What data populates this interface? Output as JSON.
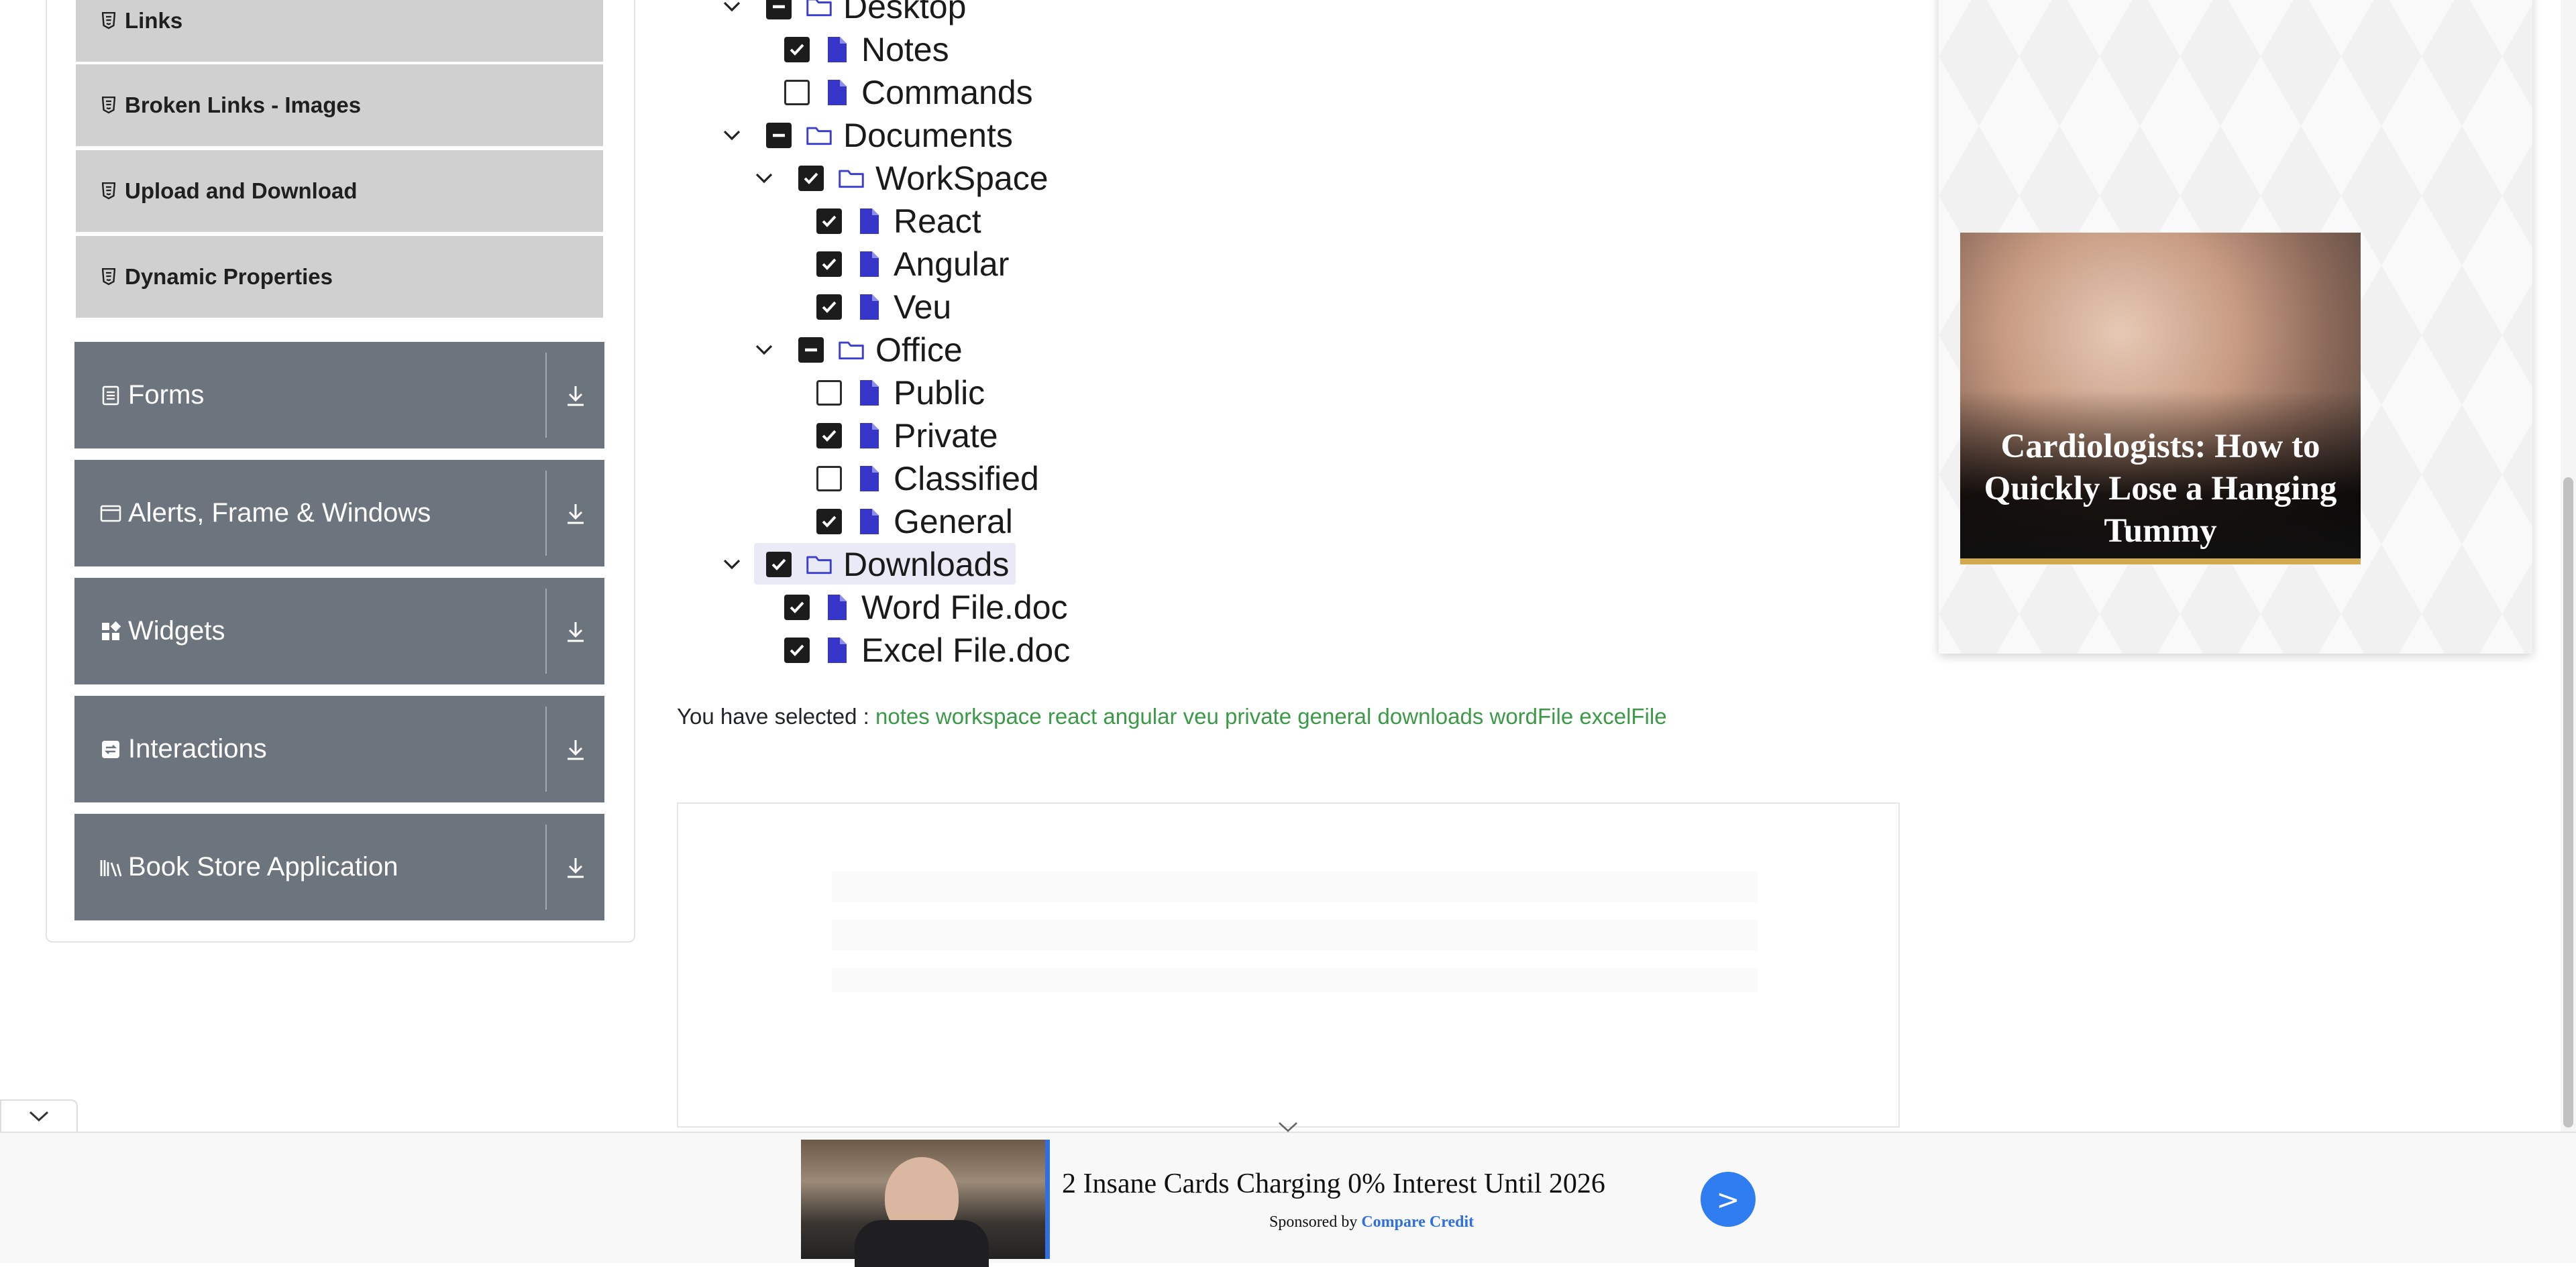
{
  "sidebar": {
    "sub_items": [
      {
        "label": "Links"
      },
      {
        "label": "Broken Links - Images"
      },
      {
        "label": "Upload and Download"
      },
      {
        "label": "Dynamic Properties"
      }
    ],
    "groups": [
      {
        "label": "Forms",
        "icon": "form-icon"
      },
      {
        "label": "Alerts, Frame & Windows",
        "icon": "window-icon"
      },
      {
        "label": "Widgets",
        "icon": "widgets-icon"
      },
      {
        "label": "Interactions",
        "icon": "interactions-icon"
      },
      {
        "label": "Book Store Application",
        "icon": "books-icon"
      }
    ]
  },
  "tree": {
    "nodes": [
      {
        "label": "Desktop",
        "state": "half",
        "type": "folder",
        "expanded": true
      },
      {
        "label": "Notes",
        "state": "checked",
        "type": "file"
      },
      {
        "label": "Commands",
        "state": "unchecked",
        "type": "file"
      },
      {
        "label": "Documents",
        "state": "half",
        "type": "folder",
        "expanded": true
      },
      {
        "label": "WorkSpace",
        "state": "checked",
        "type": "folder",
        "expanded": true
      },
      {
        "label": "React",
        "state": "checked",
        "type": "file"
      },
      {
        "label": "Angular",
        "state": "checked",
        "type": "file"
      },
      {
        "label": "Veu",
        "state": "checked",
        "type": "file"
      },
      {
        "label": "Office",
        "state": "half",
        "type": "folder",
        "expanded": true
      },
      {
        "label": "Public",
        "state": "unchecked",
        "type": "file"
      },
      {
        "label": "Private",
        "state": "checked",
        "type": "file"
      },
      {
        "label": "Classified",
        "state": "unchecked",
        "type": "file"
      },
      {
        "label": "General",
        "state": "checked",
        "type": "file"
      },
      {
        "label": "Downloads",
        "state": "checked",
        "type": "folder",
        "expanded": true,
        "highlighted": true
      },
      {
        "label": "Word File.doc",
        "state": "checked",
        "type": "file"
      },
      {
        "label": "Excel File.doc",
        "state": "checked",
        "type": "file"
      }
    ]
  },
  "selection": {
    "prefix": "You have selected :",
    "items": [
      "notes",
      "workspace",
      "react",
      "angular",
      "veu",
      "private",
      "general",
      "downloads",
      "wordFile",
      "excelFile"
    ]
  },
  "right_ad": {
    "headline": "Cardiologists: How to Quickly Lose a Hanging Tummy"
  },
  "bottom_ad": {
    "title": "2 Insane Cards Charging 0% Interest Until 2026",
    "sponsored_by": "Sponsored by",
    "brand": "Compare Credit",
    "go_label": ">"
  },
  "colors": {
    "folder_icon": "#3b3fd1",
    "file_icon": "#3636c9",
    "selected_text": "#3a9a46",
    "group_bg": "#6c757d",
    "sub_item_bg": "#d0d0d0"
  }
}
